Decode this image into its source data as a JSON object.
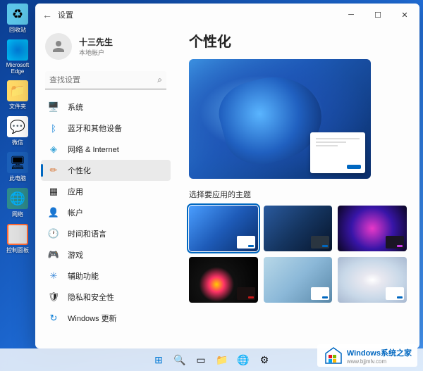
{
  "desktop": {
    "icons": [
      {
        "label": "回收站"
      },
      {
        "label": "Microsoft Edge"
      },
      {
        "label": "文件夹"
      },
      {
        "label": "微信"
      },
      {
        "label": "此电脑"
      },
      {
        "label": "网络"
      },
      {
        "label": "控制面板"
      }
    ]
  },
  "window": {
    "title": "设置",
    "profile": {
      "name": "十三先生",
      "account_type": "本地帐户"
    },
    "search": {
      "placeholder": "查找设置"
    },
    "nav": [
      {
        "icon": "🖥️",
        "label": "系统",
        "color": "#555"
      },
      {
        "icon": "ᛒ",
        "label": "蓝牙和其他设备",
        "color": "#0078d4"
      },
      {
        "icon": "◈",
        "label": "网络 & Internet",
        "color": "#3ba5d8"
      },
      {
        "icon": "✏",
        "label": "个性化",
        "color": "#d87a3b",
        "active": true
      },
      {
        "icon": "▦",
        "label": "应用",
        "color": "#555"
      },
      {
        "icon": "👤",
        "label": "帐户",
        "color": "#3b88d8"
      },
      {
        "icon": "🕐",
        "label": "时间和语言",
        "color": "#555"
      },
      {
        "icon": "🎮",
        "label": "游戏",
        "color": "#555"
      },
      {
        "icon": "✳",
        "label": "辅助功能",
        "color": "#3b88d8"
      },
      {
        "icon": "🛡",
        "label": "隐私和安全性",
        "color": "#555"
      },
      {
        "icon": "↻",
        "label": "Windows 更新",
        "color": "#0078d4"
      }
    ],
    "page": {
      "title": "个性化",
      "section_label": "选择要应用的主题",
      "themes": [
        {
          "accent": "#0067c0",
          "selected": true
        },
        {
          "accent": "#0067c0"
        },
        {
          "accent": "#c838e8"
        },
        {
          "accent": "#c81818"
        },
        {
          "accent": "#0067c0"
        },
        {
          "accent": "#0067c0"
        }
      ]
    }
  },
  "watermark": {
    "title": "Windows系统之家",
    "subtitle": "www.bjjmlv.com"
  }
}
